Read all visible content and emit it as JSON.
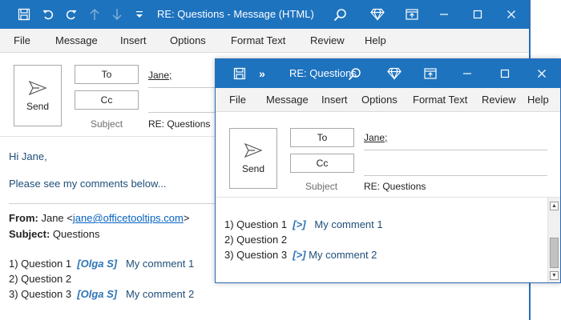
{
  "back_window": {
    "title": "RE: Questions  -  Message (HTML)",
    "menu": [
      "File",
      "Message",
      "Insert",
      "Options",
      "Format Text",
      "Review",
      "Help"
    ],
    "compose": {
      "send_label": "Send",
      "to_label": "To",
      "cc_label": "Cc",
      "to_value": "Jane;",
      "subject_label": "Subject",
      "subject_value": "RE: Questions"
    },
    "body": {
      "greeting": "Hi Jane,",
      "intro": "Please see my comments below...",
      "from_label": "From:",
      "from_name": "Jane <",
      "from_email": "jane@officetooltips.com",
      "from_close": ">",
      "subject_label": "Subject:",
      "subject_value": "Questions",
      "q1": "1) Question 1",
      "q1_tag": "[Olga S]",
      "q1_comment": "My comment 1",
      "q2": "2) Question 2",
      "q3": "3) Question 3",
      "q3_tag": "[Olga S]",
      "q3_comment": "My comment 2"
    }
  },
  "front_window": {
    "title": "RE: Questions",
    "more_icon": "»",
    "menu": [
      "File",
      "Message",
      "Insert",
      "Options",
      "Format Text",
      "Review",
      "Help"
    ],
    "compose": {
      "send_label": "Send",
      "to_label": "To",
      "cc_label": "Cc",
      "to_value": "Jane;",
      "subject_label": "Subject",
      "subject_value": "RE: Questions"
    },
    "body": {
      "q1": "1) Question 1",
      "q1_tag": "[>]",
      "q1_comment": "My comment 1",
      "q2": "2) Question 2",
      "q3": "3) Question 3",
      "q3_tag": "[>]",
      "q3_comment": "My comment 2"
    }
  },
  "colors": {
    "titlebar": "#1e73be",
    "accent_text": "#1f4e79",
    "tag": "#2e74b5",
    "link": "#0563c1"
  }
}
